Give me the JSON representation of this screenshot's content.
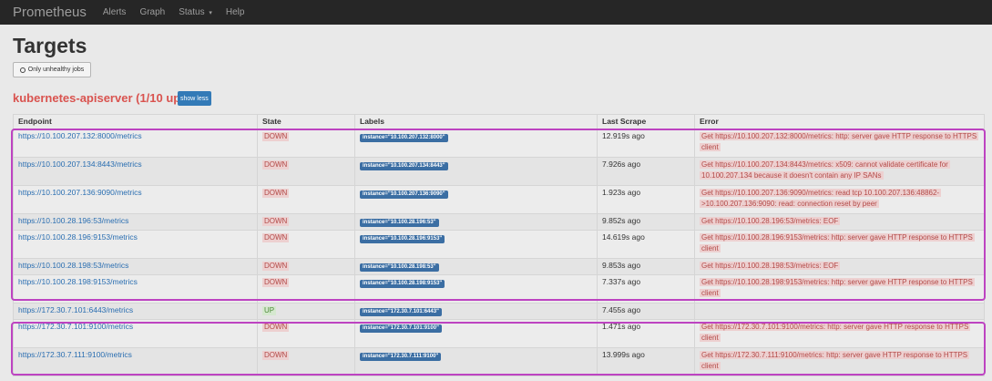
{
  "nav": {
    "brand": "Prometheus",
    "items": [
      "Alerts",
      "Graph",
      "Status",
      "Help"
    ],
    "status_caret": "▾"
  },
  "page_title": "Targets",
  "filter_button": "Only unhealthy jobs",
  "job": {
    "title": "kubernetes-apiserver (1/10 up)",
    "toggle_label": "show less"
  },
  "table": {
    "headers": [
      "Endpoint",
      "State",
      "Labels",
      "Last Scrape",
      "Error"
    ],
    "rows": [
      {
        "endpoint": "https://10.100.207.132:8000/metrics",
        "state": "DOWN",
        "label": "instance=\"10.100.207.132:8000\"",
        "last_scrape": "12.919s ago",
        "error": "Get https://10.100.207.132:8000/metrics: http: server gave HTTP response to HTTPS client"
      },
      {
        "endpoint": "https://10.100.207.134:8443/metrics",
        "state": "DOWN",
        "label": "instance=\"10.100.207.134:8443\"",
        "last_scrape": "7.926s ago",
        "error": "Get https://10.100.207.134:8443/metrics: x509: cannot validate certificate for 10.100.207.134 because it doesn't contain any IP SANs"
      },
      {
        "endpoint": "https://10.100.207.136:9090/metrics",
        "state": "DOWN",
        "label": "instance=\"10.100.207.136:9090\"",
        "last_scrape": "1.923s ago",
        "error": "Get https://10.100.207.136:9090/metrics: read tcp 10.100.207.136:48862->10.100.207.136:9090: read: connection reset by peer"
      },
      {
        "endpoint": "https://10.100.28.196:53/metrics",
        "state": "DOWN",
        "label": "instance=\"10.100.28.196:53\"",
        "last_scrape": "9.852s ago",
        "error": "Get https://10.100.28.196:53/metrics: EOF"
      },
      {
        "endpoint": "https://10.100.28.196:9153/metrics",
        "state": "DOWN",
        "label": "instance=\"10.100.28.196:9153\"",
        "last_scrape": "14.619s ago",
        "error": "Get https://10.100.28.196:9153/metrics: http: server gave HTTP response to HTTPS client"
      },
      {
        "endpoint": "https://10.100.28.198:53/metrics",
        "state": "DOWN",
        "label": "instance=\"10.100.28.198:53\"",
        "last_scrape": "9.853s ago",
        "error": "Get https://10.100.28.198:53/metrics: EOF"
      },
      {
        "endpoint": "https://10.100.28.198:9153/metrics",
        "state": "DOWN",
        "label": "instance=\"10.100.28.198:9153\"",
        "last_scrape": "7.337s ago",
        "error": "Get https://10.100.28.198:9153/metrics: http: server gave HTTP response to HTTPS client"
      },
      {
        "endpoint": "https://172.30.7.101:6443/metrics",
        "state": "UP",
        "label": "instance=\"172.30.7.101:6443\"",
        "last_scrape": "7.455s ago",
        "error": ""
      },
      {
        "endpoint": "https://172.30.7.101:9100/metrics",
        "state": "DOWN",
        "label": "instance=\"172.30.7.101:9100\"",
        "last_scrape": "1.471s ago",
        "error": "Get https://172.30.7.101:9100/metrics: http: server gave HTTP response to HTTPS client"
      },
      {
        "endpoint": "https://172.30.7.111:9100/metrics",
        "state": "DOWN",
        "label": "instance=\"172.30.7.111:9100\"",
        "last_scrape": "13.999s ago",
        "error": "Get https://172.30.7.111:9100/metrics: http: server gave HTTP response to HTTPS client"
      }
    ]
  },
  "colors": {
    "navbar": "#262626",
    "job_title": "#d9534f",
    "down_badge_bg": "#edd0d0",
    "up_badge_bg": "#d5e8cf",
    "label_badge_bg": "#3b6ea3",
    "highlight_box": "#bd43c1"
  }
}
